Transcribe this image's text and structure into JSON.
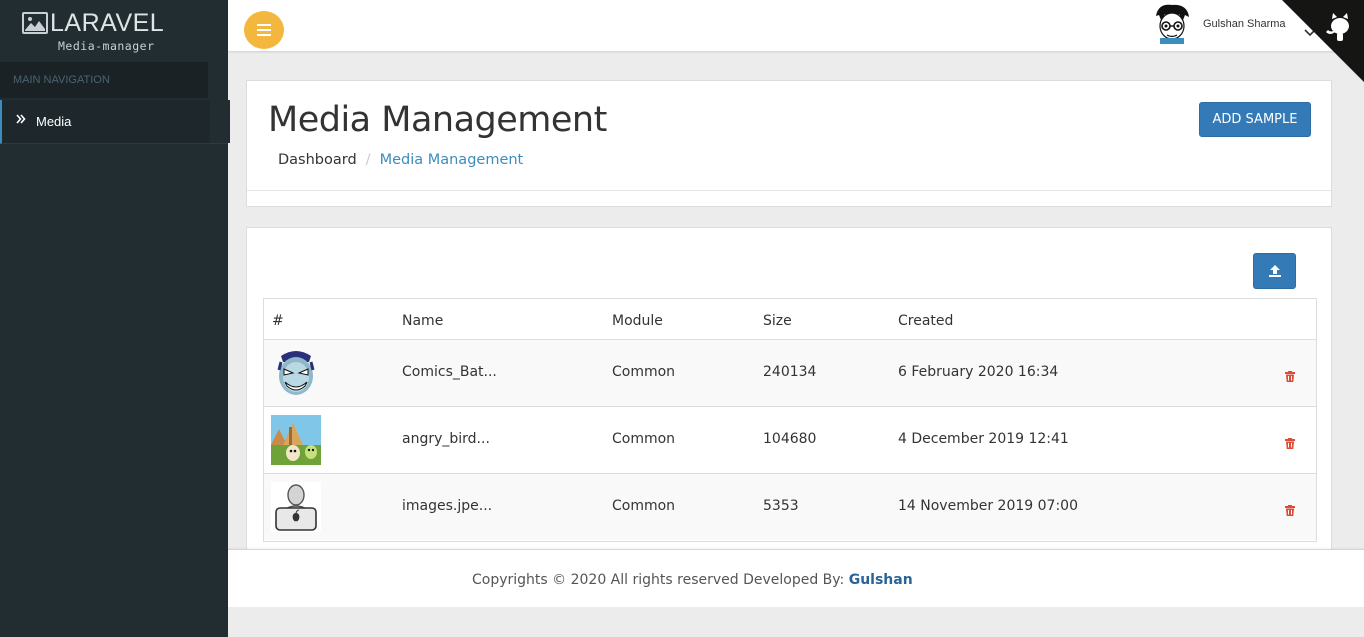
{
  "brand": {
    "title": "LARAVEL",
    "subtitle": "Media-manager",
    "icon": "image-icon"
  },
  "sidebar": {
    "header": "MAIN NAVIGATION",
    "items": [
      {
        "label": "Media",
        "icon": "double-chevron-right-icon"
      }
    ]
  },
  "topbar": {
    "user_name": "Gulshan Sharma",
    "menu_icon": "hamburger-icon",
    "accent": "#f3b73d"
  },
  "page": {
    "title": "Media Management",
    "breadcrumb": [
      "Dashboard",
      "Media Management"
    ],
    "add_button": "ADD SAMPLE"
  },
  "table": {
    "columns": [
      "#",
      "Name",
      "Module",
      "Size",
      "Created"
    ],
    "rows": [
      {
        "thumb": "comic-face-thumbnail",
        "name": "Comics_Bat...",
        "module": "Common",
        "size": "240134",
        "created": "6 February 2020 16:34"
      },
      {
        "thumb": "angry-birds-thumbnail",
        "name": "angry_bird...",
        "module": "Common",
        "size": "104680",
        "created": "4 December 2019 12:41"
      },
      {
        "thumb": "laptop-user-thumbnail",
        "name": "images.jpe...",
        "module": "Common",
        "size": "5353",
        "created": "14 November 2019 07:00"
      }
    ]
  },
  "footer": {
    "text": "Copyrights © 2020 All rights reserved Developed By: ",
    "link": "Gulshan"
  },
  "colors": {
    "primary": "#337ab7",
    "sidebar": "#222d32",
    "danger": "#dd4b39",
    "link": "#3c8dbc"
  }
}
